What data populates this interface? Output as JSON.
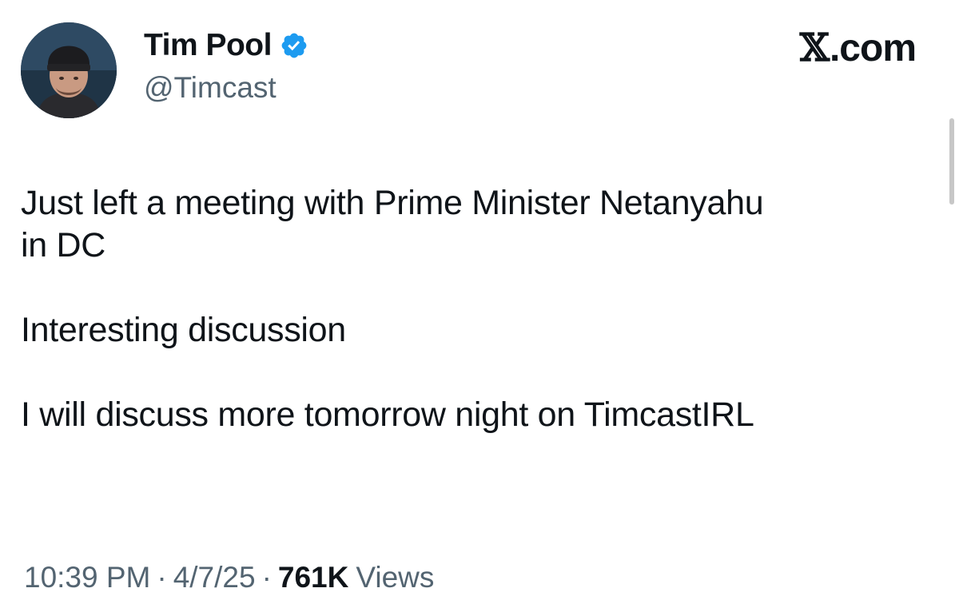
{
  "tweet": {
    "author": {
      "display_name": "Tim Pool",
      "handle": "@Timcast",
      "verified_icon": "verified-badge-icon",
      "verified_color": "#1d9bf0"
    },
    "brand": {
      "x_glyph": "𝕏",
      "domain": ".com"
    },
    "text": {
      "line1": "Just left a meeting with Prime Minister Netanyahu",
      "line2": "in DC",
      "line3": "Interesting discussion",
      "line4": "I will discuss more tomorrow night on TimcastIRL"
    },
    "meta": {
      "time": "10:39 PM",
      "separator": "·",
      "date": "4/7/25",
      "views_count": "761K",
      "views_label": "Views"
    }
  }
}
